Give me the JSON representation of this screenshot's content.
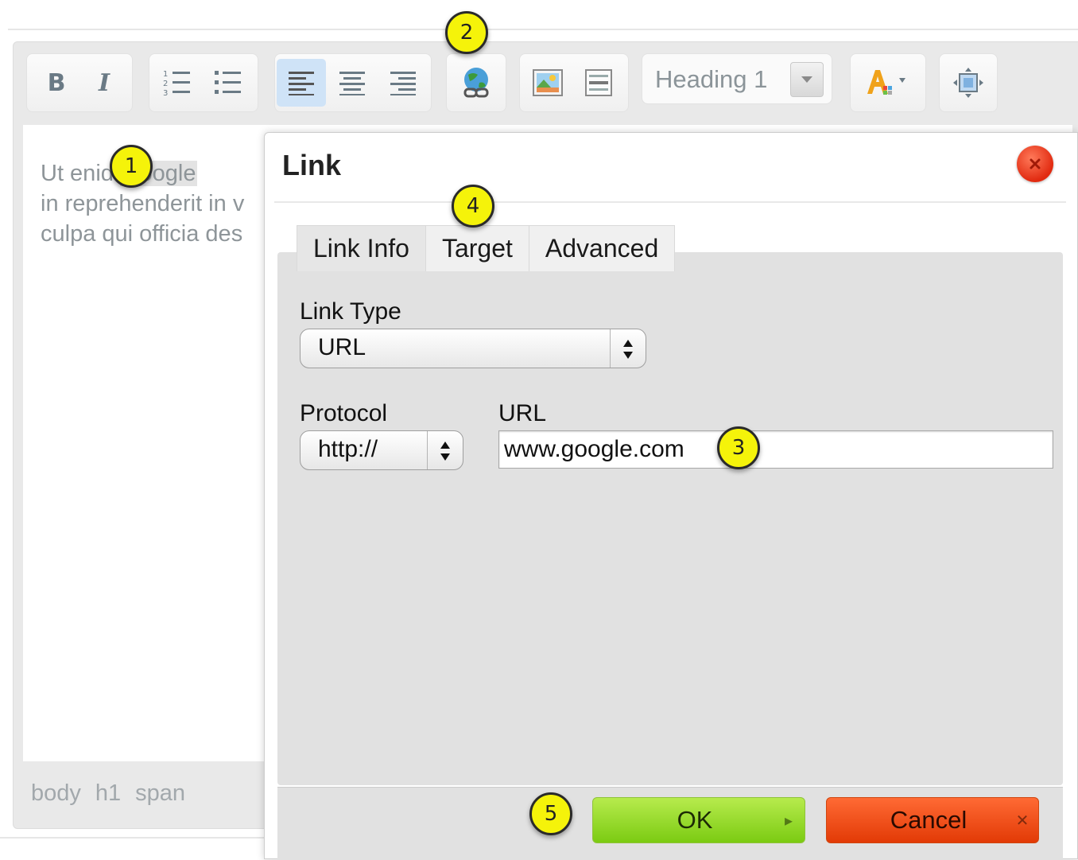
{
  "toolbar": {
    "heading_value": "Heading 1",
    "buttons": [
      "bold",
      "italic",
      "numbered-list",
      "bulleted-list",
      "align-left",
      "align-center",
      "align-right",
      "link",
      "image",
      "horizontal-rule",
      "text-color",
      "source"
    ]
  },
  "editor": {
    "content_before": "Ut eni",
    "content_hidden": "d",
    "content_link": "Google",
    "content_line2": "in reprehenderit in v",
    "content_line3": "culpa qui officia des",
    "status_path": [
      "body",
      "h1",
      "span"
    ]
  },
  "dialog": {
    "title": "Link",
    "tabs": [
      {
        "label": "Link Info",
        "active": true
      },
      {
        "label": "Target",
        "active": false
      },
      {
        "label": "Advanced",
        "active": false
      }
    ],
    "link_type_label": "Link Type",
    "link_type_value": "URL",
    "protocol_label": "Protocol",
    "protocol_value": "http://",
    "url_label": "URL",
    "url_value": "www.google.com",
    "ok_label": "OK",
    "cancel_label": "Cancel"
  },
  "callouts": [
    "1",
    "2",
    "3",
    "4",
    "5"
  ],
  "colors": {
    "callout": "#f5f30a",
    "ok_green": "#8bd61f",
    "cancel_red": "#f0501a",
    "active_align": "#cfe3f7"
  }
}
